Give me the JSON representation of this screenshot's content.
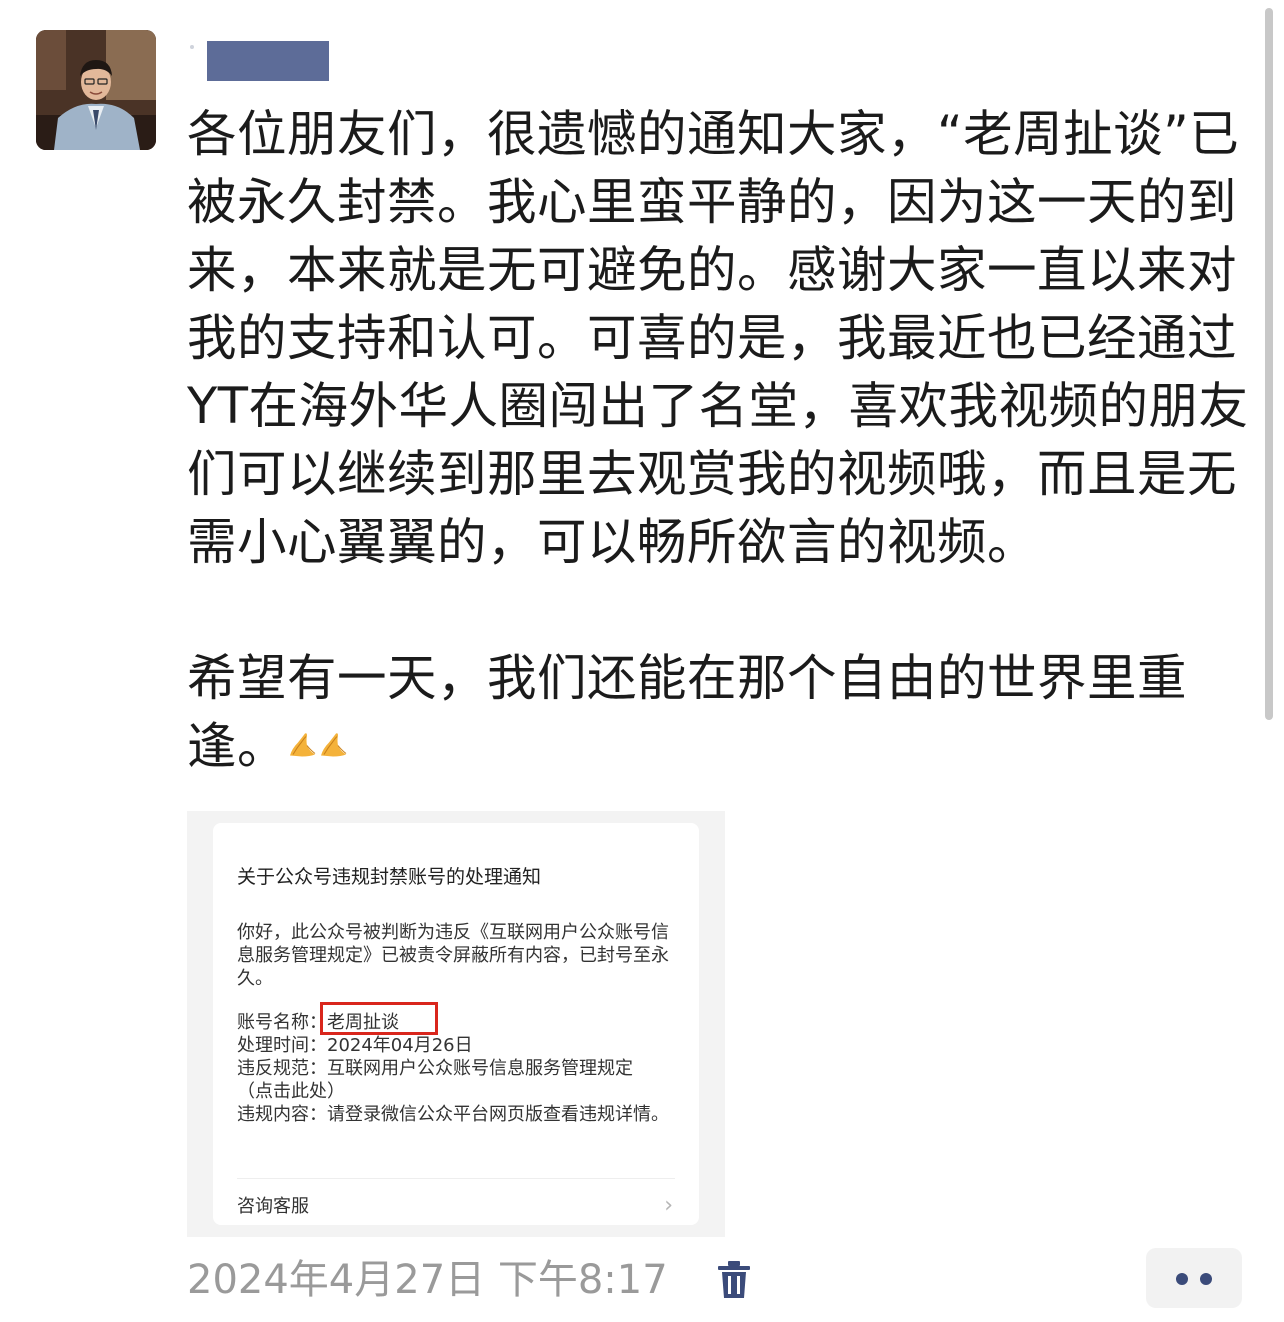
{
  "post": {
    "paragraphs": [
      "各位朋友们，很遗憾的通知大家，“老周扯谈”已被永久封禁。我心里蛮平静的，因为这一天的到来，本来就是无可避免的。感谢大家一直以来对我的支持和认可。可喜的是，我最近也已经通过YT在海外华人圈闯出了名堂，喜欢我视频的朋友们可以继续到那里去观赏我的视频哦，而且是无需小心翼翼的，可以畅所欲言的视频。",
      "希望有一天，我们还能在那个自由的世界里重逢。"
    ],
    "emoji": "🙏🙏",
    "emoji_icon": "praying-hands-icon",
    "timestamp": "2024年4月27日 下午8:17"
  },
  "notice": {
    "title": "关于公众号违规封禁账号的处理通知",
    "body": "你好，此公众号被判断为违反《互联网用户公众账号信息服务管理规定》已被责令屏蔽所有内容，已封号至永久。",
    "account_label": "账号名称：",
    "account_value": "老周扯谈",
    "time_label": "处理时间：",
    "time_value": "2024年04月26日",
    "rule_label": "违反规范：",
    "rule_value": "互联网用户公众账号信息服务管理规定",
    "rule_link": "（点击此处）",
    "content_label": "违规内容：",
    "content_value": "请登录微信公众平台网页版查看违规详情。",
    "service_label": "咨询客服",
    "highlight_color": "#d9261c"
  },
  "colors": {
    "name_redaction": "#5d6c98",
    "timestamp": "#9a9a9a",
    "icon_blue": "#3b4b7a"
  }
}
